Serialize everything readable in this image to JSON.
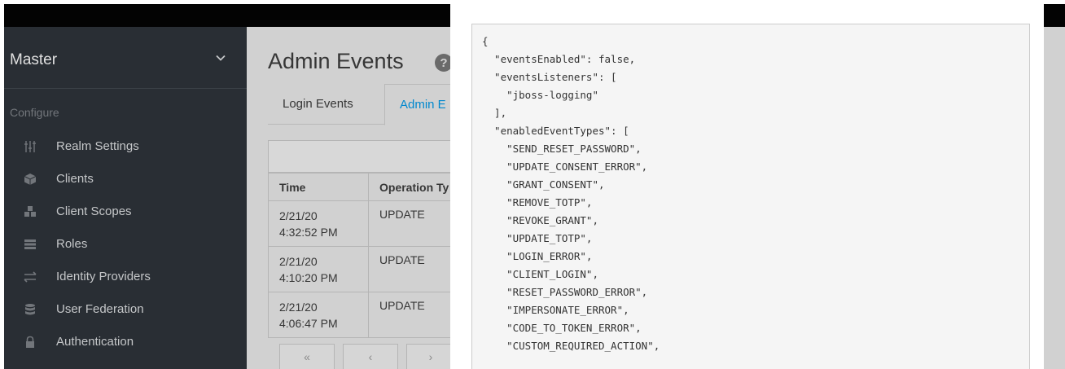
{
  "realm": {
    "name": "Master"
  },
  "sidebar": {
    "section": "Configure",
    "items": [
      {
        "label": "Realm Settings",
        "icon": "sliders-icon"
      },
      {
        "label": "Clients",
        "icon": "cube-icon"
      },
      {
        "label": "Client Scopes",
        "icon": "cubes-icon"
      },
      {
        "label": "Roles",
        "icon": "list-icon"
      },
      {
        "label": "Identity Providers",
        "icon": "exchange-icon"
      },
      {
        "label": "User Federation",
        "icon": "database-icon"
      },
      {
        "label": "Authentication",
        "icon": "lock-icon"
      }
    ]
  },
  "page": {
    "title": "Admin Events"
  },
  "tabs": [
    {
      "label": "Login Events"
    },
    {
      "label": "Admin E"
    }
  ],
  "table": {
    "headers": [
      "Time",
      "Operation Ty"
    ],
    "rows": [
      {
        "date": "2/21/20",
        "time": "4:32:52 PM",
        "op": "UPDATE"
      },
      {
        "date": "2/21/20",
        "time": "4:10:20 PM",
        "op": "UPDATE"
      },
      {
        "date": "2/21/20",
        "time": "4:06:47 PM",
        "op": "UPDATE"
      }
    ]
  },
  "pager": {
    "first": "«",
    "prev": "‹",
    "next": "›"
  },
  "json_lines": [
    "{",
    "  \"eventsEnabled\": false,",
    "  \"eventsListeners\": [",
    "    \"jboss-logging\"",
    "  ],",
    "  \"enabledEventTypes\": [",
    "    \"SEND_RESET_PASSWORD\",",
    "    \"UPDATE_CONSENT_ERROR\",",
    "    \"GRANT_CONSENT\",",
    "    \"REMOVE_TOTP\",",
    "    \"REVOKE_GRANT\",",
    "    \"UPDATE_TOTP\",",
    "    \"LOGIN_ERROR\",",
    "    \"CLIENT_LOGIN\",",
    "    \"RESET_PASSWORD_ERROR\",",
    "    \"IMPERSONATE_ERROR\",",
    "    \"CODE_TO_TOKEN_ERROR\",",
    "    \"CUSTOM_REQUIRED_ACTION\","
  ]
}
